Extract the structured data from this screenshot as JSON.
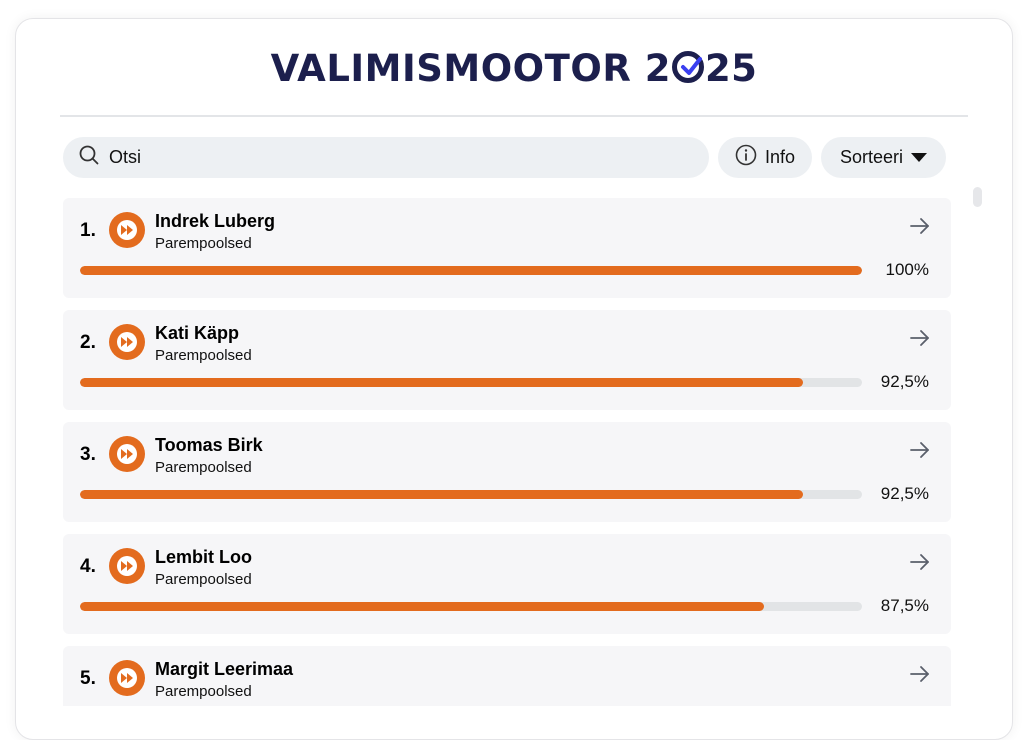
{
  "header": {
    "logo_part1": "VALIMISMOOTOR 2",
    "logo_part2": "25",
    "logo_color": "#1c1f4d",
    "logo_check_color": "#3a3ff0"
  },
  "toolbar": {
    "search_placeholder": "Otsi",
    "search_icon": "search-icon",
    "info_label": "Info",
    "info_icon": "info-icon",
    "sort_label": "Sorteeri",
    "sort_icon": "caret-down-icon"
  },
  "accent_color": "#e36b1e",
  "candidates": [
    {
      "rank": "1.",
      "name": "Indrek Luberg",
      "party": "Parempoolsed",
      "match_label": "100%",
      "match": 1.0
    },
    {
      "rank": "2.",
      "name": "Kati Käpp",
      "party": "Parempoolsed",
      "match_label": "92,5%",
      "match": 0.925
    },
    {
      "rank": "3.",
      "name": "Toomas Birk",
      "party": "Parempoolsed",
      "match_label": "92,5%",
      "match": 0.925
    },
    {
      "rank": "4.",
      "name": "Lembit Loo",
      "party": "Parempoolsed",
      "match_label": "87,5%",
      "match": 0.875
    },
    {
      "rank": "5.",
      "name": "Margit Leerimaa",
      "party": "Parempoolsed",
      "match_label": "",
      "match": null
    }
  ]
}
